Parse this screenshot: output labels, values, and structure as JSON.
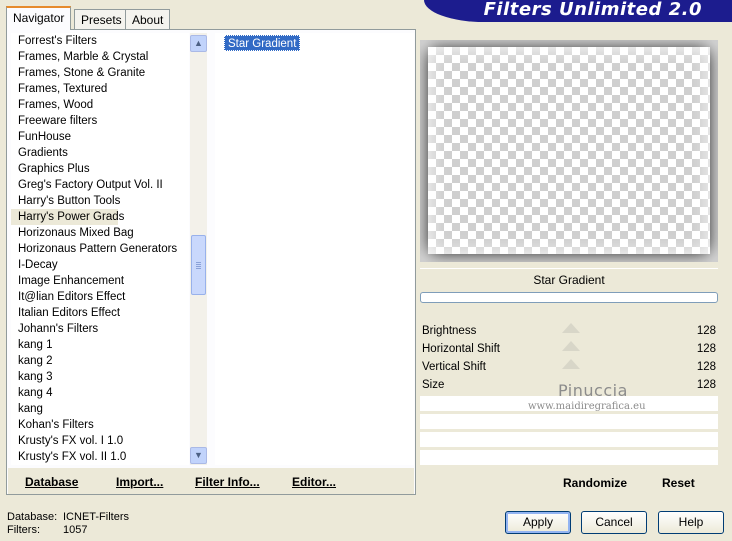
{
  "tabs": [
    {
      "label": "Navigator"
    },
    {
      "label": "Presets"
    },
    {
      "label": "About"
    }
  ],
  "banner_title": "Filters Unlimited 2.0",
  "categories": [
    "Forrest's Filters",
    "Frames, Marble & Crystal",
    "Frames, Stone & Granite",
    "Frames, Textured",
    "Frames, Wood",
    "Freeware filters",
    "FunHouse",
    "Gradients",
    "Graphics Plus",
    "Greg's Factory Output Vol. II",
    "Harry's Button Tools",
    "Harry's Power Grads",
    "Horizonaus Mixed Bag",
    "Horizonaus Pattern Generators",
    "I-Decay",
    "Image Enhancement",
    "It@lian Editors Effect",
    "Italian Editors Effect",
    "Johann's Filters",
    "kang 1",
    "kang 2",
    "kang 3",
    "kang 4",
    "kang",
    "Kohan's Filters",
    "Krusty's FX vol. I 1.0",
    "Krusty's FX vol. II 1.0"
  ],
  "selected_category": "Harry's Power Grads",
  "filters": [
    "Star Gradient"
  ],
  "nav_buttons": {
    "database": "Database",
    "import": "Import...",
    "filter_info": "Filter Info...",
    "editor": "Editor..."
  },
  "filter_name": "Star Gradient",
  "sliders": [
    {
      "label": "Brightness",
      "value": "128"
    },
    {
      "label": "Horizontal Shift",
      "value": "128"
    },
    {
      "label": "Vertical Shift",
      "value": "128"
    },
    {
      "label": "Size",
      "value": "128"
    }
  ],
  "watermark": {
    "line1": "Pinuccia",
    "line2": "www.maidiregrafica.eu"
  },
  "randomize_label": "Randomize",
  "reset_label": "Reset",
  "footer": {
    "database_label": "Database:",
    "database_value": "ICNET-Filters",
    "filters_label": "Filters:",
    "filters_value": "1057"
  },
  "buttons": {
    "apply": "Apply",
    "cancel": "Cancel",
    "help": "Help"
  },
  "colors": {
    "banner": "#1c1c8e",
    "selection": "#316ac5",
    "tab_accent": "#e68b2c"
  }
}
